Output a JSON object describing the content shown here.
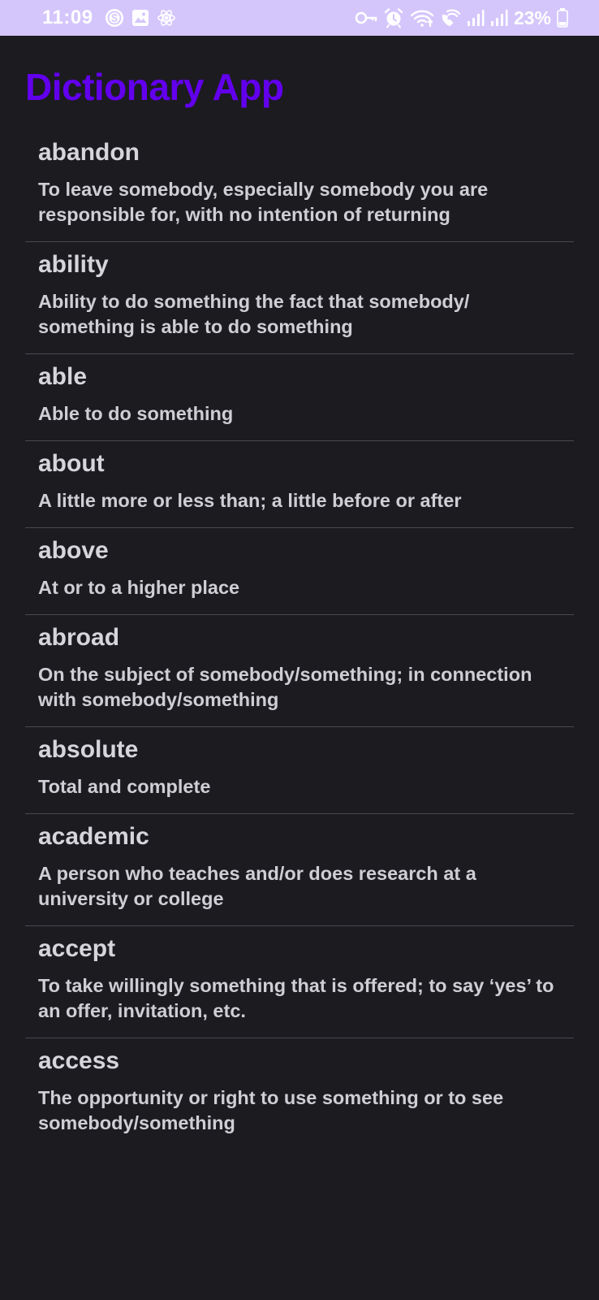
{
  "status_bar": {
    "time": "11:09",
    "battery_percent": "23%",
    "left_icons": [
      "s-circle-icon",
      "gallery-icon",
      "atom-icon"
    ],
    "right_icons": [
      "key-icon",
      "alarm-icon",
      "wifi-icon",
      "wifi-call-icon",
      "signal-icon",
      "signal-icon",
      "battery-icon"
    ],
    "background_color": "#d4c6fb"
  },
  "app": {
    "title": "Dictionary App",
    "title_color": "#6200ee",
    "background_color": "#1c1b20"
  },
  "words": [
    {
      "term": "abandon",
      "definition": "To leave somebody, especially somebody you are responsible for, with no intention of returning"
    },
    {
      "term": "ability",
      "definition": "Ability to do something the fact that somebody/ something is able to do something"
    },
    {
      "term": "able",
      "definition": "Able to do something"
    },
    {
      "term": "about",
      "definition": "A little more or less than; a little before or after"
    },
    {
      "term": "above",
      "definition": "At or to a higher place"
    },
    {
      "term": "abroad",
      "definition": "On the subject of somebody/something; in connection with somebody/something"
    },
    {
      "term": "absolute",
      "definition": "Total and complete"
    },
    {
      "term": "academic",
      "definition": "A person who teaches and/or does research at a university or college"
    },
    {
      "term": "accept",
      "definition": "To take willingly something that is offered; to say ‘yes’ to an offer, invitation, etc."
    },
    {
      "term": "access",
      "definition": "The opportunity or right to use something or to see somebody/something"
    }
  ]
}
